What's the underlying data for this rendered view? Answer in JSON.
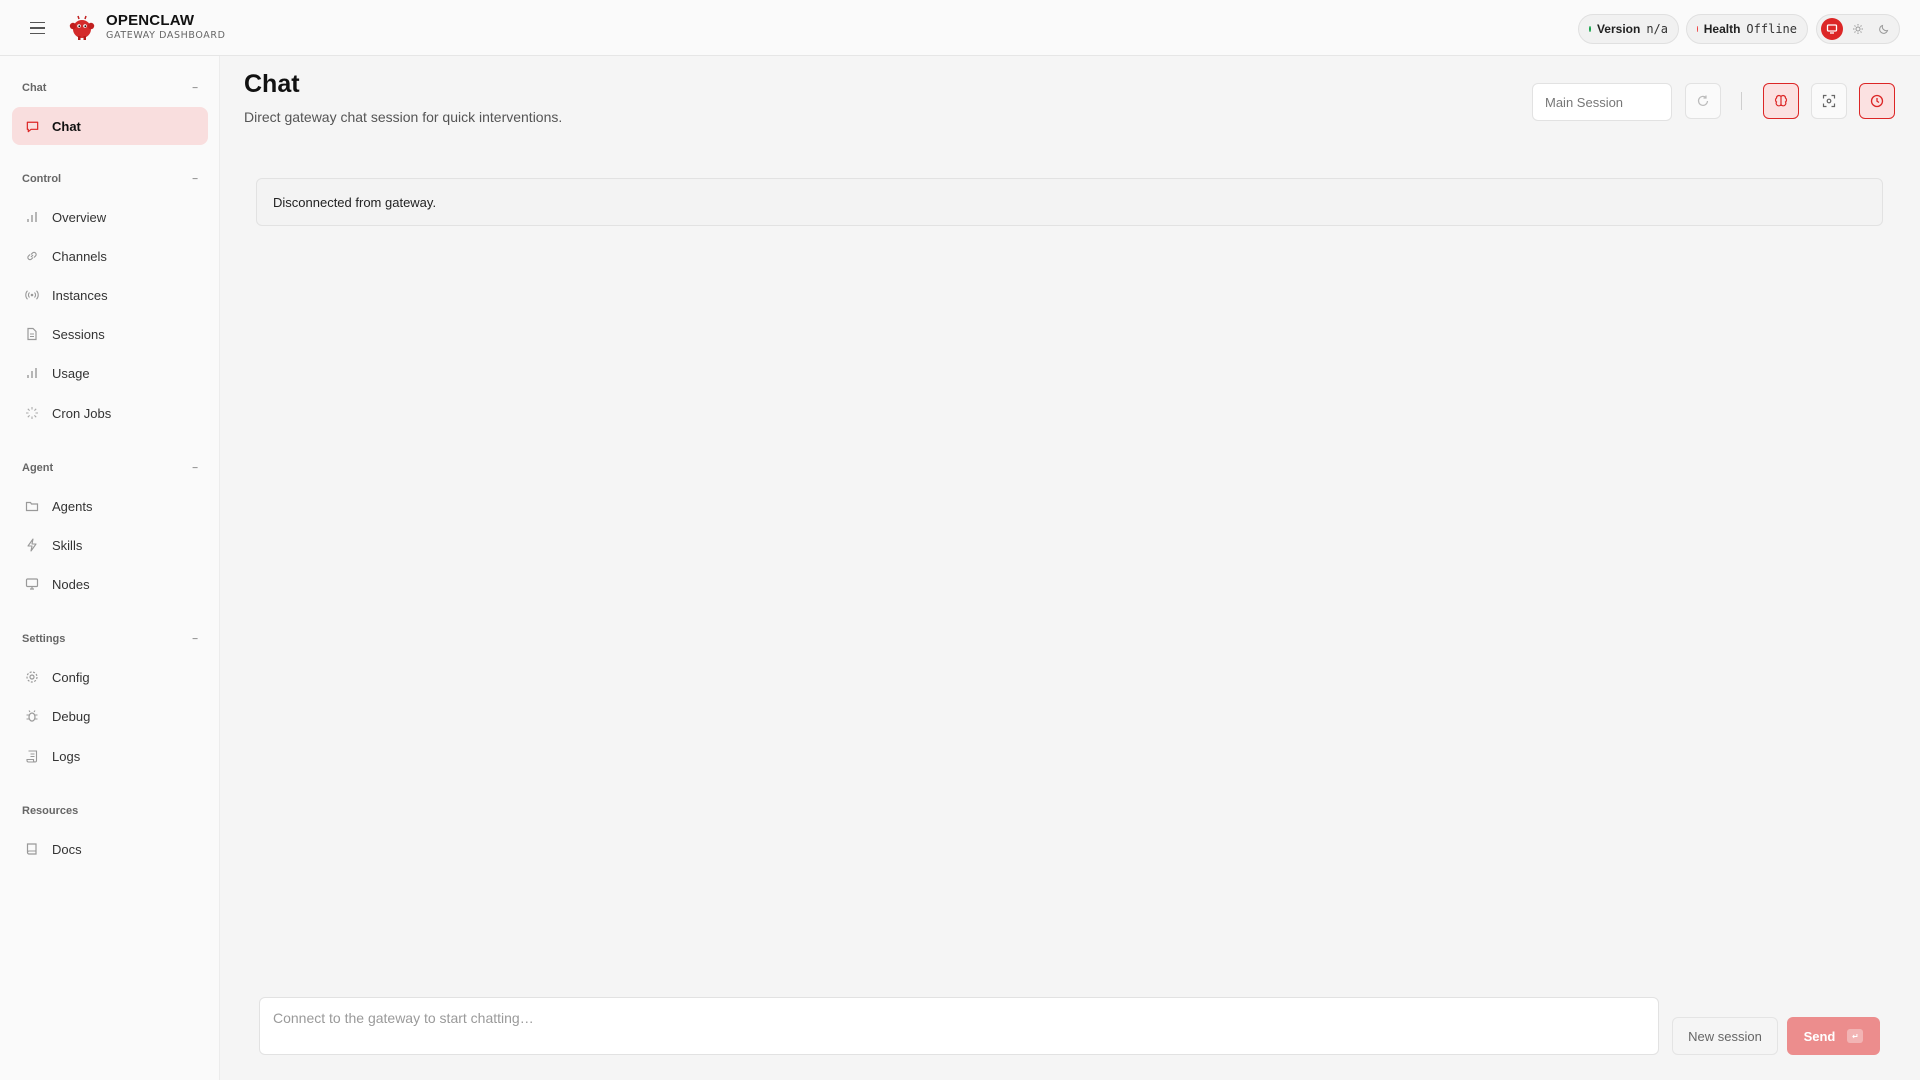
{
  "header": {
    "brand_name": "OPENCLAW",
    "brand_sub": "GATEWAY DASHBOARD",
    "version_label": "Version",
    "version_value": "n/a",
    "health_label": "Health",
    "health_value": "Offline",
    "colors": {
      "accent": "#dc2626",
      "ok": "#16a34a",
      "bad": "#ef4444"
    }
  },
  "sidebar": {
    "sections": [
      {
        "title": "Chat",
        "collapse": "−",
        "items": [
          {
            "label": "Chat",
            "icon": "message-icon",
            "active": true
          }
        ]
      },
      {
        "title": "Control",
        "collapse": "−",
        "items": [
          {
            "label": "Overview",
            "icon": "bar-chart-icon"
          },
          {
            "label": "Channels",
            "icon": "link-icon"
          },
          {
            "label": "Instances",
            "icon": "radio-icon"
          },
          {
            "label": "Sessions",
            "icon": "file-icon"
          },
          {
            "label": "Usage",
            "icon": "bar-chart-icon"
          },
          {
            "label": "Cron Jobs",
            "icon": "loader-icon"
          }
        ]
      },
      {
        "title": "Agent",
        "collapse": "−",
        "items": [
          {
            "label": "Agents",
            "icon": "folder-icon"
          },
          {
            "label": "Skills",
            "icon": "zap-icon"
          },
          {
            "label": "Nodes",
            "icon": "monitor-icon"
          }
        ]
      },
      {
        "title": "Settings",
        "collapse": "−",
        "items": [
          {
            "label": "Config",
            "icon": "gear-icon"
          },
          {
            "label": "Debug",
            "icon": "bug-icon"
          },
          {
            "label": "Logs",
            "icon": "scroll-icon"
          }
        ]
      },
      {
        "title": "Resources",
        "items": [
          {
            "label": "Docs",
            "icon": "book-icon"
          }
        ]
      }
    ]
  },
  "main": {
    "title": "Chat",
    "subtitle": "Direct gateway chat session for quick interventions.",
    "session_select": "Main Session",
    "alert": "Disconnected from gateway.",
    "composer_placeholder": "Connect to the gateway to start chatting…",
    "new_session_label": "New session",
    "send_label": "Send",
    "send_kbd": "↵"
  }
}
